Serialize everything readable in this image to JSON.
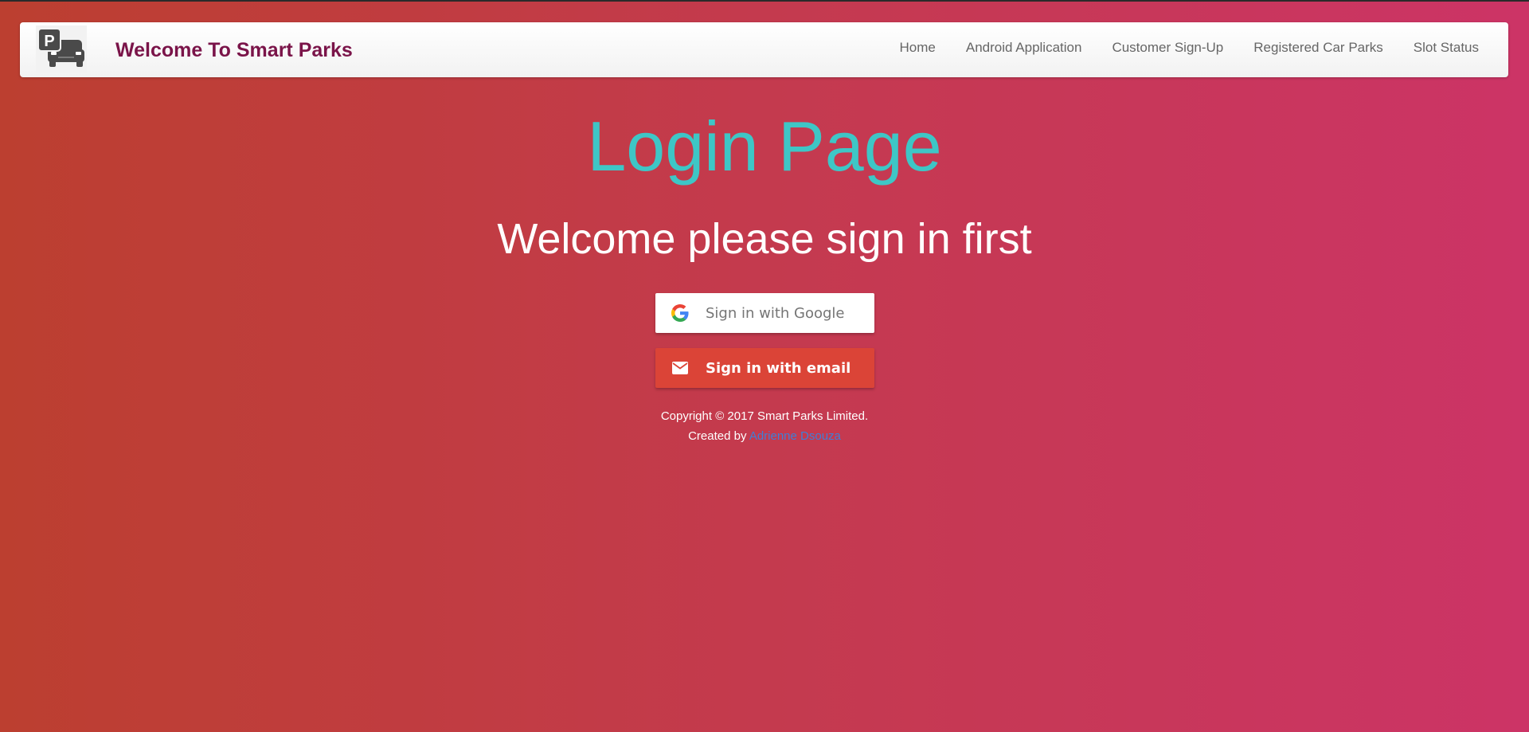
{
  "header": {
    "brand": "Welcome To Smart Parks",
    "logo_letter": "P",
    "nav": [
      {
        "label": "Home"
      },
      {
        "label": "Android Application"
      },
      {
        "label": "Customer Sign-Up"
      },
      {
        "label": "Registered Car Parks"
      },
      {
        "label": "Slot Status"
      }
    ]
  },
  "main": {
    "title": "Login Page",
    "subtitle": "Welcome please sign in first",
    "google_button": "Sign in with Google",
    "email_button": "Sign in with email"
  },
  "footer": {
    "copyright": "Copyright © 2017 Smart Parks Limited.",
    "created_by": "Created by",
    "author": "Adrienne Dsouza"
  },
  "icons": {
    "logo": "parking-car-icon",
    "google": "google-g-icon",
    "email": "envelope-icon"
  },
  "colors": {
    "title": "#3ec6c6",
    "brand": "#7a1449",
    "email_button": "#db4437",
    "link": "#3f7fd6"
  }
}
